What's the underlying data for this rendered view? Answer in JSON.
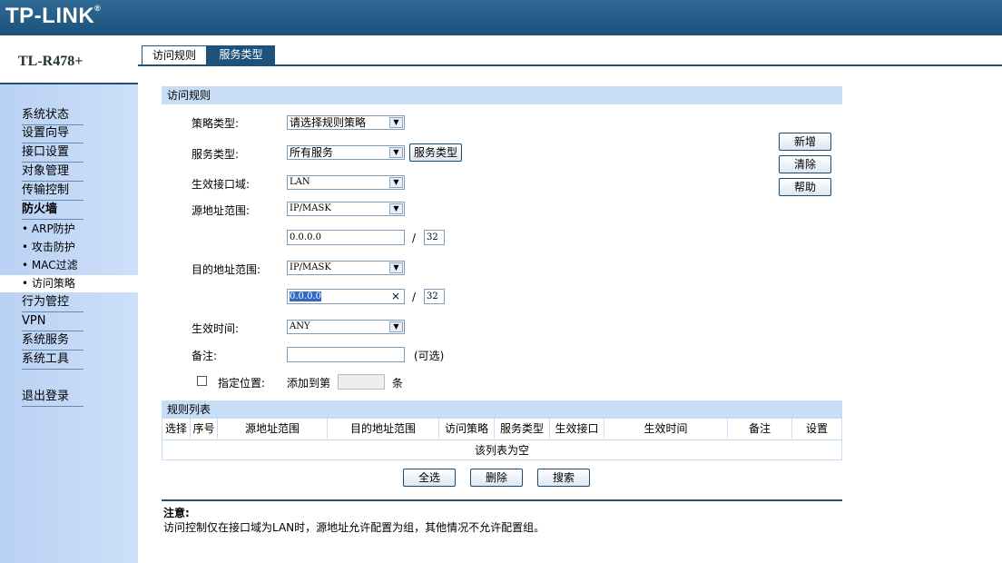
{
  "header": {
    "logo": "TP-LINK",
    "logo_mark": "®"
  },
  "model": "TL-R478+",
  "sidebar": {
    "items": [
      "系统状态",
      "设置向导",
      "接口设置",
      "对象管理",
      "传输控制",
      "防火墙"
    ],
    "firewall_sub": [
      "• ARP防护",
      "• 攻击防护",
      "• MAC过滤",
      "• 访问策略"
    ],
    "items2": [
      "行为管控",
      "VPN",
      "系统服务",
      "系统工具"
    ],
    "logout": "退出登录"
  },
  "tabs": [
    "访问规则",
    "服务类型"
  ],
  "form": {
    "section_title": "访问规则",
    "policy_type": {
      "label": "策略类型:",
      "value": "请选择规则策略"
    },
    "service_type": {
      "label": "服务类型:",
      "value": "所有服务",
      "button": "服务类型"
    },
    "interface": {
      "label": "生效接口域:",
      "value": "LAN"
    },
    "src_range": {
      "label": "源地址范围:",
      "mode": "IP/MASK",
      "ip": "0.0.0.0",
      "mask": "32"
    },
    "dst_range": {
      "label": "目的地址范围:",
      "mode": "IP/MASK",
      "ip": "0.0.0.0",
      "mask": "32",
      "clear": "×"
    },
    "slash": "/",
    "time": {
      "label": "生效时间:",
      "value": "ANY"
    },
    "note": {
      "label": "备注:",
      "value": "",
      "hint": "(可选)"
    },
    "position": {
      "label": "指定位置:",
      "prefix": "添加到第",
      "value": "",
      "suffix": "条"
    }
  },
  "actions": {
    "add": "新增",
    "clear": "清除",
    "help": "帮助"
  },
  "rules": {
    "title": "规则列表",
    "columns": [
      "选择",
      "序号",
      "源地址范围",
      "目的地址范围",
      "访问策略",
      "服务类型",
      "生效接口",
      "生效时间",
      "备注",
      "设置"
    ],
    "empty": "该列表为空",
    "select_all": "全选",
    "delete": "删除",
    "search": "搜索"
  },
  "notice": {
    "title": "注意:",
    "text": "访问控制仅在接口域为LAN时，源地址允许配置为组，其他情况不允许配置组。"
  },
  "icons": {
    "dropdown": "chevron-down-icon",
    "checkbox": "checkbox-icon"
  },
  "colors": {
    "header": "#1c527c",
    "sidebar": "#c3d9f7",
    "section": "#c7dcf5",
    "selection": "#316ac5"
  }
}
